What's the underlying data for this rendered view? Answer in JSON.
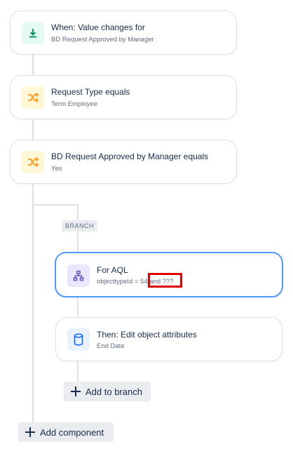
{
  "trigger": {
    "title": "When: Value changes for",
    "subtitle": "BD Request Approved by Manager",
    "icon": "download-arrow-icon",
    "color": "#00875a"
  },
  "condition1": {
    "title": "Request Type equals",
    "subtitle": "Term Employee",
    "icon": "shuffle-icon",
    "color": "#ff991f"
  },
  "condition2": {
    "title": "BD Request Approved by Manager equals",
    "subtitle": "Yes",
    "icon": "shuffle-icon",
    "color": "#ff991f"
  },
  "branch": {
    "tag": "BRANCH",
    "aql": {
      "title": "For AQL",
      "subtitle": "objecttypeId = 54 and ???",
      "icon": "hierarchy-icon",
      "color": "#6554c0"
    },
    "action": {
      "title": "Then: Edit object attributes",
      "subtitle": "End Date",
      "icon": "database-icon",
      "color": "#0065ff"
    },
    "add_label": "Add to branch"
  },
  "add_component_label": "Add component"
}
